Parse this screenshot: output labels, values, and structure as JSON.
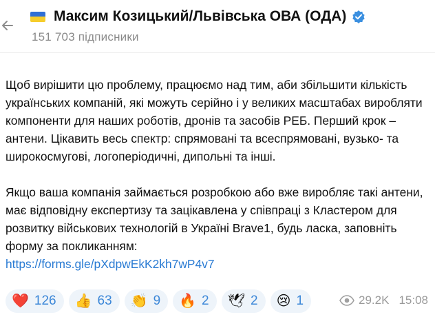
{
  "header": {
    "channel_name": "Максим Козицький/Львівська ОВА (ОДА)",
    "subscribers": "151 703 підписники"
  },
  "message": {
    "paragraph1": "Щоб вирішити цю проблему, працюємо над тим, аби збільшити кількість українських компаній, які можуть серійно і у великих масштабах виробляти компоненти для наших роботів, дронів та засобів РЕБ. Перший крок – антени. Цікавить весь спектр: спрямовані та всеспрямовані, вузько- та широкосмугові, логоперіодичні, дипольні та інші.",
    "paragraph2": "Якщо ваша компанія займається розробкою або вже виробляє такі антени, має відповідну експертизу та зацікавлена у співпраці з Кластером для розвитку військових технологій в Україні Brave1, будь ласка, заповніть форму за покликанням:",
    "link": "https://forms.gle/pXdpwEkK2kh7wP4v7"
  },
  "reactions": [
    {
      "emoji": "❤️",
      "icon": "heart-icon",
      "count": "126"
    },
    {
      "emoji": "👍",
      "icon": "thumbs-up-icon",
      "count": "63"
    },
    {
      "emoji": "👏",
      "icon": "clapping-hands-icon",
      "count": "9"
    },
    {
      "emoji": "🔥",
      "icon": "fire-icon",
      "count": "2"
    },
    {
      "emoji": "🕊",
      "icon": "dove-icon",
      "count": "2"
    },
    {
      "emoji": "😢",
      "icon": "crying-face-icon",
      "count": "1"
    }
  ],
  "meta": {
    "views": "29.2K",
    "time": "15:08"
  },
  "colors": {
    "link": "#2a7bd3",
    "reaction_bg": "#eef4fa",
    "reaction_count": "#3c87d8",
    "verified": "#3a8fe0"
  }
}
